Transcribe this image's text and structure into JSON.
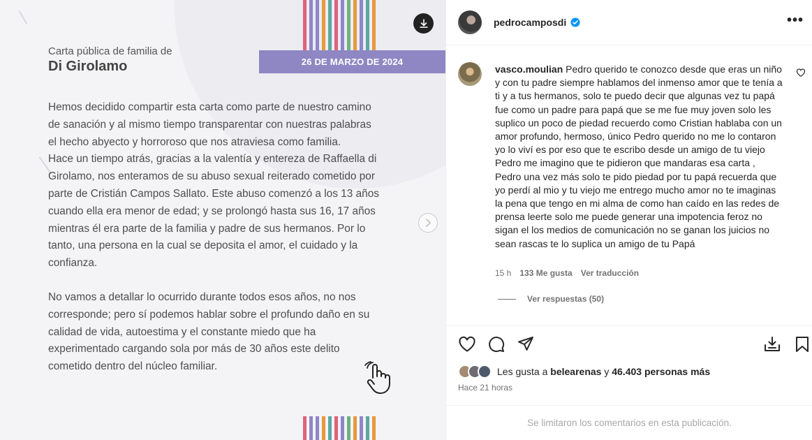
{
  "post": {
    "date_label": "26 DE MARZO DE 2024",
    "letter_subtitle": "Carta pública de familia de",
    "letter_title": "Di Girolamo",
    "paragraphs": [
      "Hemos decidido compartir esta carta como parte de nuestro camino\nde sanación y al mismo tiempo transparentar con nuestras palabras\nel hecho abyecto y horroroso que nos atraviesa como familia.\nHace un tiempo atrás, gracias a la valentía y entereza de Raffaella di\nGirolamo, nos enteramos de su abuso sexual reiterado cometido por\nparte de Cristián Campos Sallato. Este abuso comenzó a los 13 años\ncuando ella era menor de edad; y se prolongó hasta sus 16, 17 años\nmientras él era parte de la familia y padre de sus hermanos. Por lo\ntanto, una persona en la cual se deposita el amor, el cuidado y la\nconfianza.",
      "No vamos a detallar lo ocurrido durante todos esos años, no nos\ncorresponde; pero sí podemos hablar sobre el profundo daño en su\ncalidad de vida, autoestima y el constante miedo que ha\nexperimentado cargando sola por más de 30 años este delito\ncometido dentro del núcleo familiar."
    ],
    "stripe_colors": [
      "#e0627a",
      "#8f86c9",
      "#8f86c9",
      "#e59a3e",
      "#5fa7a0",
      "#e0627a",
      "#8f86c9",
      "#6cb27f",
      "#e59a3e",
      "#8f86c9",
      "#5fa7a0",
      "#e59a3e"
    ],
    "band_color": "#8e87c4",
    "icons": {
      "download": "download-icon",
      "next": "chevron-right-icon",
      "hand": "swipe-hand-icon"
    }
  },
  "panel": {
    "username": "pedrocampos​di",
    "more_label": "•••",
    "comment": {
      "username": "vasco.moulian",
      "text": "Pedro querido te conozco desde que eras un niño y con tu padre siempre hablamos del inmenso amor que te tenía a ti y a tus hermanos, solo te puedo decir que algunas vez tu papá fue como un padre para papá que se me fue muy joven solo les suplico un poco de piedad recuerdo como Cristian hablaba con un amor profundo, hermoso, único Pedro querido no me lo contaron yo lo viví es por eso que te escribo desde un amigo de tu viejo Pedro me imagino que te pidieron que mandaras esa carta , Pedro una vez más solo te pido piedad por tu papá recuerda que yo perdí al mio y tu viejo me entrego mucho amor no te imaginas la pena que tengo en mi alma de como han caído en las redes de prensa leerte solo me puede generar una impotencia feroz no sigan el los medios de comunicación no se ganan los juicios no sean rascas te lo suplica un amigo de tu Papá",
      "time": "15 h",
      "likes": "133 Me gusta",
      "translate": "Ver traducción",
      "replies": "Ver respuestas (50)"
    },
    "likes_prefix": "Les gusta a",
    "likes_user": "belearenas",
    "likes_conj": "y",
    "likes_count": "46.403 personas más",
    "time_ago": "Hace 21 horas",
    "footer": "Se limitaron los comentarios en esta publicación.",
    "icons": [
      "heart-icon",
      "comment-icon",
      "share-icon",
      "save-to-collection-icon",
      "bookmark-icon"
    ],
    "verified_color": "#0095f6"
  }
}
